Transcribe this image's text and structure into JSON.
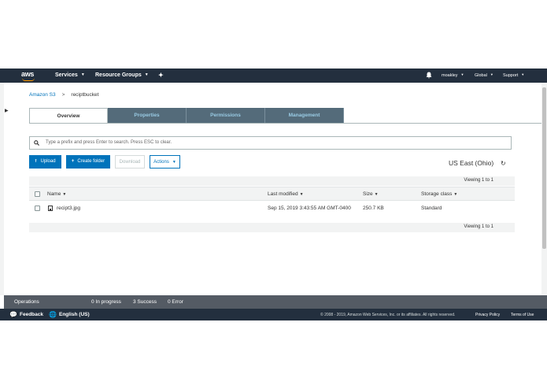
{
  "nav": {
    "logo": "aws",
    "services": "Services",
    "resource_groups": "Resource Groups",
    "user": "moakley",
    "region": "Global",
    "support": "Support"
  },
  "breadcrumb": {
    "root": "Amazon S3",
    "separator": ">",
    "bucket": "reciptbucket"
  },
  "tabs": [
    "Overview",
    "Properties",
    "Permissions",
    "Management"
  ],
  "search": {
    "placeholder": "Type a prefix and press Enter to search. Press ESC to clear."
  },
  "toolbar": {
    "upload": "Upload",
    "create_folder": "Create folder",
    "download": "Download",
    "actions": "Actions",
    "region": "US East (Ohio)"
  },
  "table": {
    "viewing_top": "Viewing 1 to 1",
    "viewing_bottom": "Viewing 1 to 1",
    "columns": [
      "Name",
      "Last modified",
      "Size",
      "Storage class"
    ],
    "rows": [
      {
        "name": "recipt3.jpg",
        "modified": "Sep 15, 2019 3:43:55 AM GMT-0400",
        "size": "250.7 KB",
        "storage": "Standard"
      }
    ]
  },
  "ops": {
    "label": "Operations",
    "in_progress": "0 In progress",
    "success": "3 Success",
    "error": "0 Error"
  },
  "footer": {
    "feedback": "Feedback",
    "language": "English (US)",
    "copyright": "© 2008 - 2019, Amazon Web Services, Inc. or its affiliates. All rights reserved.",
    "privacy": "Privacy Policy",
    "terms": "Terms of Use"
  },
  "colors": {
    "nav_bg": "#232f3e",
    "accent": "#0073bb",
    "tab_bg": "#546b7a",
    "ops_bg": "#545b64",
    "logo_orange": "#ff9900"
  }
}
